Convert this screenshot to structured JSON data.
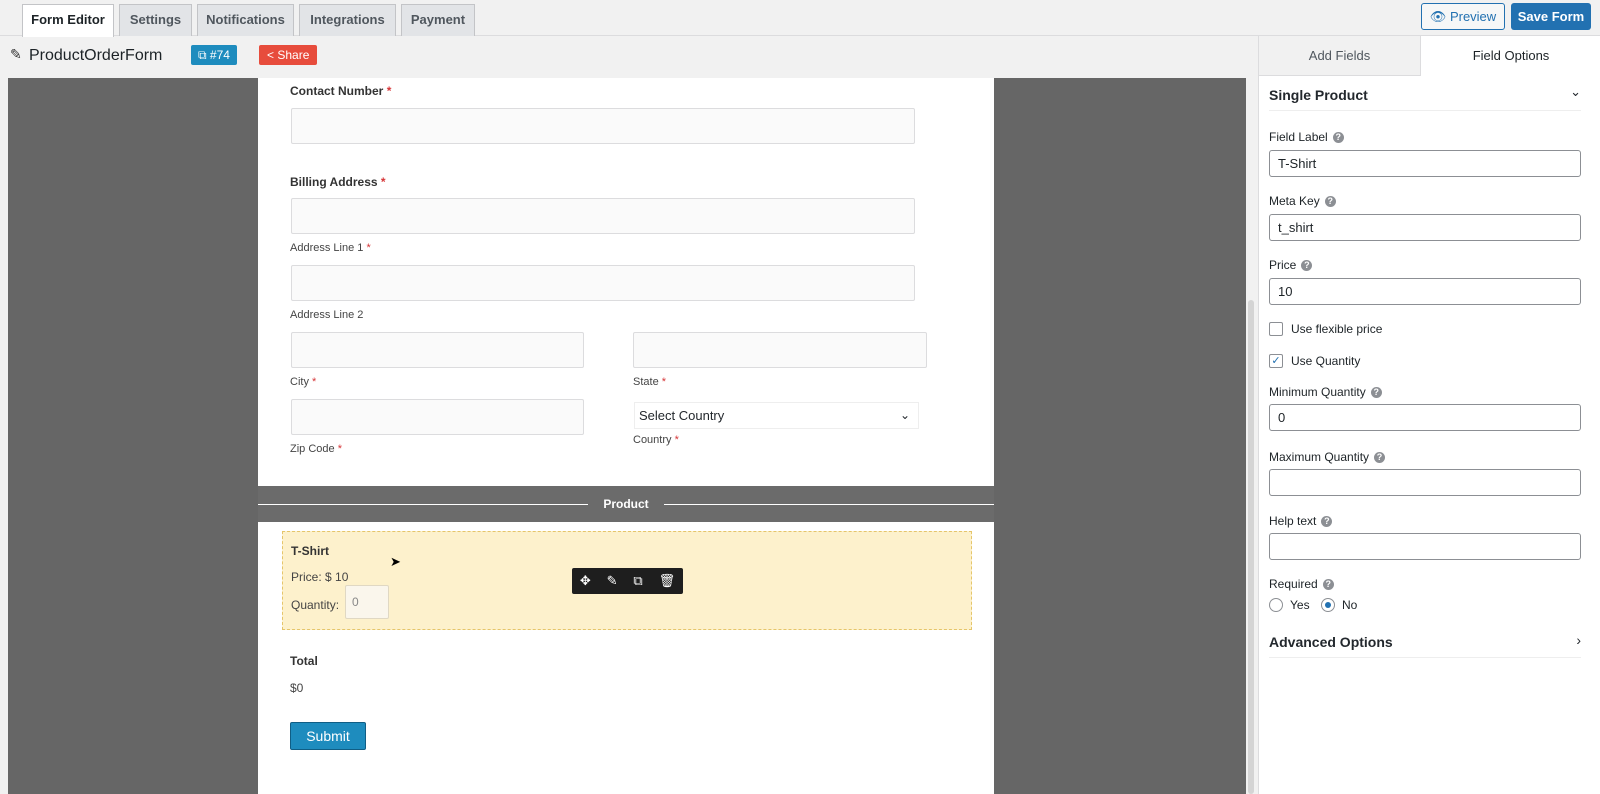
{
  "tabs": [
    "Form Editor",
    "Settings",
    "Notifications",
    "Integrations",
    "Payment"
  ],
  "header": {
    "preview_label": "Preview",
    "save_label": "Save Form",
    "form_title": "ProductOrderForm",
    "form_id": "#74",
    "share_label": "Share"
  },
  "form": {
    "contact_label": "Contact Number",
    "billing_label": "Billing Address",
    "address1": "Address Line 1",
    "address2": "Address Line 2",
    "city": "City",
    "state": "State",
    "zip": "Zip Code",
    "country": "Country",
    "country_select": "Select Country",
    "required_mark": "*",
    "section_title": "Product",
    "product_name": "T-Shirt",
    "price_label": "Price:",
    "price_value": "$ 10",
    "quantity_label": "Quantity:",
    "quantity_value": "0",
    "total_label": "Total",
    "total_value": "$0",
    "submit_label": "Submit"
  },
  "panel": {
    "tabs": [
      "Add Fields",
      "Field Options"
    ],
    "section_title": "Single Product",
    "field_label": "Field Label",
    "field_label_value": "T-Shirt",
    "meta_key": "Meta Key",
    "meta_key_value": "t_shirt",
    "price": "Price",
    "price_value": "10",
    "flexible_price": "Use flexible price",
    "flexible_checked": false,
    "use_quantity": "Use Quantity",
    "use_quantity_checked": true,
    "min_qty": "Minimum Quantity",
    "min_qty_value": "0",
    "max_qty": "Maximum Quantity",
    "max_qty_value": "",
    "help_text": "Help text",
    "help_text_value": "",
    "required": "Required",
    "yes": "Yes",
    "no": "No",
    "required_selected": "No",
    "advanced": "Advanced Options"
  }
}
